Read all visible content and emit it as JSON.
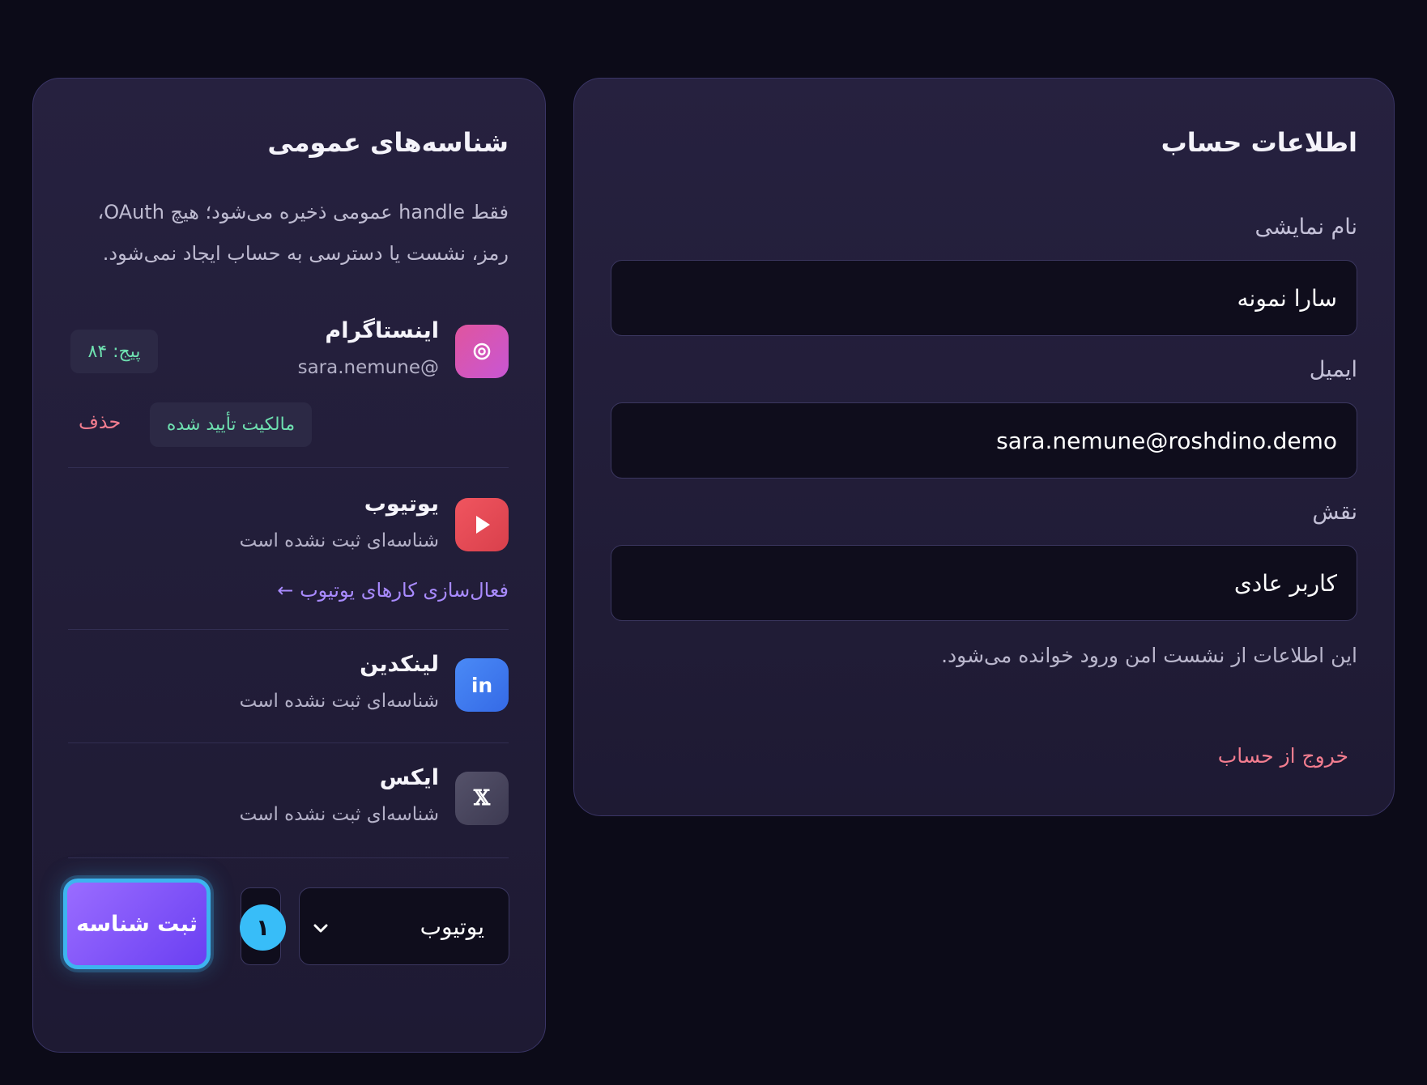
{
  "account": {
    "title": "اطلاعات حساب",
    "display_name_label": "نام نمایشی",
    "display_name_value": "سارا نمونه",
    "email_label": "ایمیل",
    "email_value": "sara.nemune@roshdino.demo",
    "role_label": "نقش",
    "role_value": "کاربر عادی",
    "note": "این اطلاعات از نشست امن ورود خوانده می‌شود.",
    "logout_label": "خروج از حساب"
  },
  "handles": {
    "title": "شناسه‌های عمومی",
    "description": "فقط handle عمومی ذخیره می‌شود؛ هیچ OAuth، رمز، نشست یا دسترسی به حساب ایجاد نمی‌شود.",
    "platforms": [
      {
        "name": "اینستاگرام",
        "handle": "sara.nemune@",
        "icon": "instagram-icon",
        "color": "#e0559e",
        "page_badge": "پیج: ۸۴",
        "verified_badge": "مالکیت تأیید شده",
        "delete_label": "حذف"
      },
      {
        "name": "یوتیوب",
        "handle": "شناسه‌ای ثبت نشده است",
        "icon": "youtube-icon",
        "color": "#ec4c57",
        "activate_link": "فعال‌سازی کارهای یوتیوب ←"
      },
      {
        "name": "لینکدین",
        "handle": "شناسه‌ای ثبت نشده است",
        "icon": "linkedin-icon",
        "icon_text": "in",
        "color": "#3f7bf0"
      },
      {
        "name": "ایکس",
        "handle": "شناسه‌ای ثبت نشده است",
        "icon": "x-icon",
        "icon_text": "𝕏",
        "color": "#4a4760"
      }
    ],
    "form": {
      "platform_select_value": "یوتیوب",
      "step_badge": "۱",
      "submit_label": "ثبت شناسه"
    }
  }
}
